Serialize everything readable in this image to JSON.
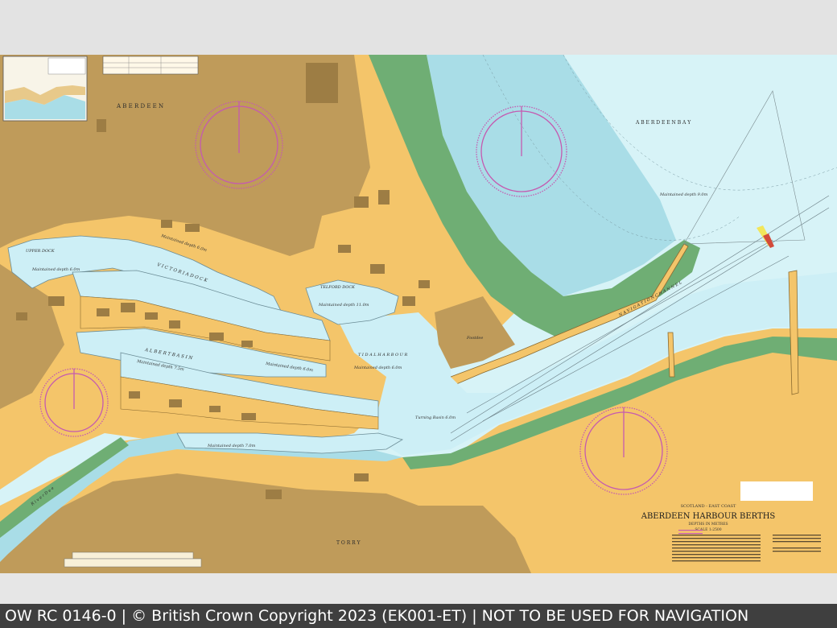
{
  "status_bar": {
    "text": "OW RC 0146-0 | © British Crown Copyright 2023 (EK001-ET) | NOT TO BE USED FOR NAVIGATION"
  },
  "map": {
    "place_labels": {
      "aberdeen_town": "A B E R D E E N",
      "aberdeen_bay": "A B E R D E E N     B A Y",
      "upper_dock": "UPPER DOCK",
      "victoria_dock": "V I C T O R I A   D O C K",
      "albert_basin": "A L B E R T   B A S I N",
      "telford_dock": "TELFORD DOCK",
      "tidal_harbour": "T I D A L   H A R B O U R",
      "navigation_channel": "N A V I G A T I O N   C H A N N E L",
      "torry": "T O R R Y",
      "footdee": "Footdee",
      "river_dee": "R i v e r   D e e"
    },
    "depth_notes": {
      "upper": "Maintained depth 6.0m",
      "victoria": "Maintained depth 6.0m",
      "albert": "Maintained depth 7.5m",
      "albert_east": "Maintained depth 6.0m",
      "telford": "Maintained depth 11.0m",
      "tidal": "Maintained depth 6.0m",
      "turning": "Turning Basin 6.0m",
      "torry_quay": "Maintained depth 7.0m",
      "bay": "Maintained depth 9.0m"
    },
    "colors": {
      "land": "#f4c56a",
      "built_up": "#bf9b5a",
      "intertidal": "#6fae74",
      "shallow_water": "#a9dde7",
      "deep_water": "#d7f3f7",
      "dock_water": "#cdeff6",
      "compass": "#c55ab0"
    }
  },
  "title_block": {
    "region": "SCOTLAND - EAST COAST",
    "title": "ABERDEEN HARBOUR BERTHS",
    "subtitle": "DEPTHS IN METRES",
    "scale": "SCALE 1:2500"
  }
}
